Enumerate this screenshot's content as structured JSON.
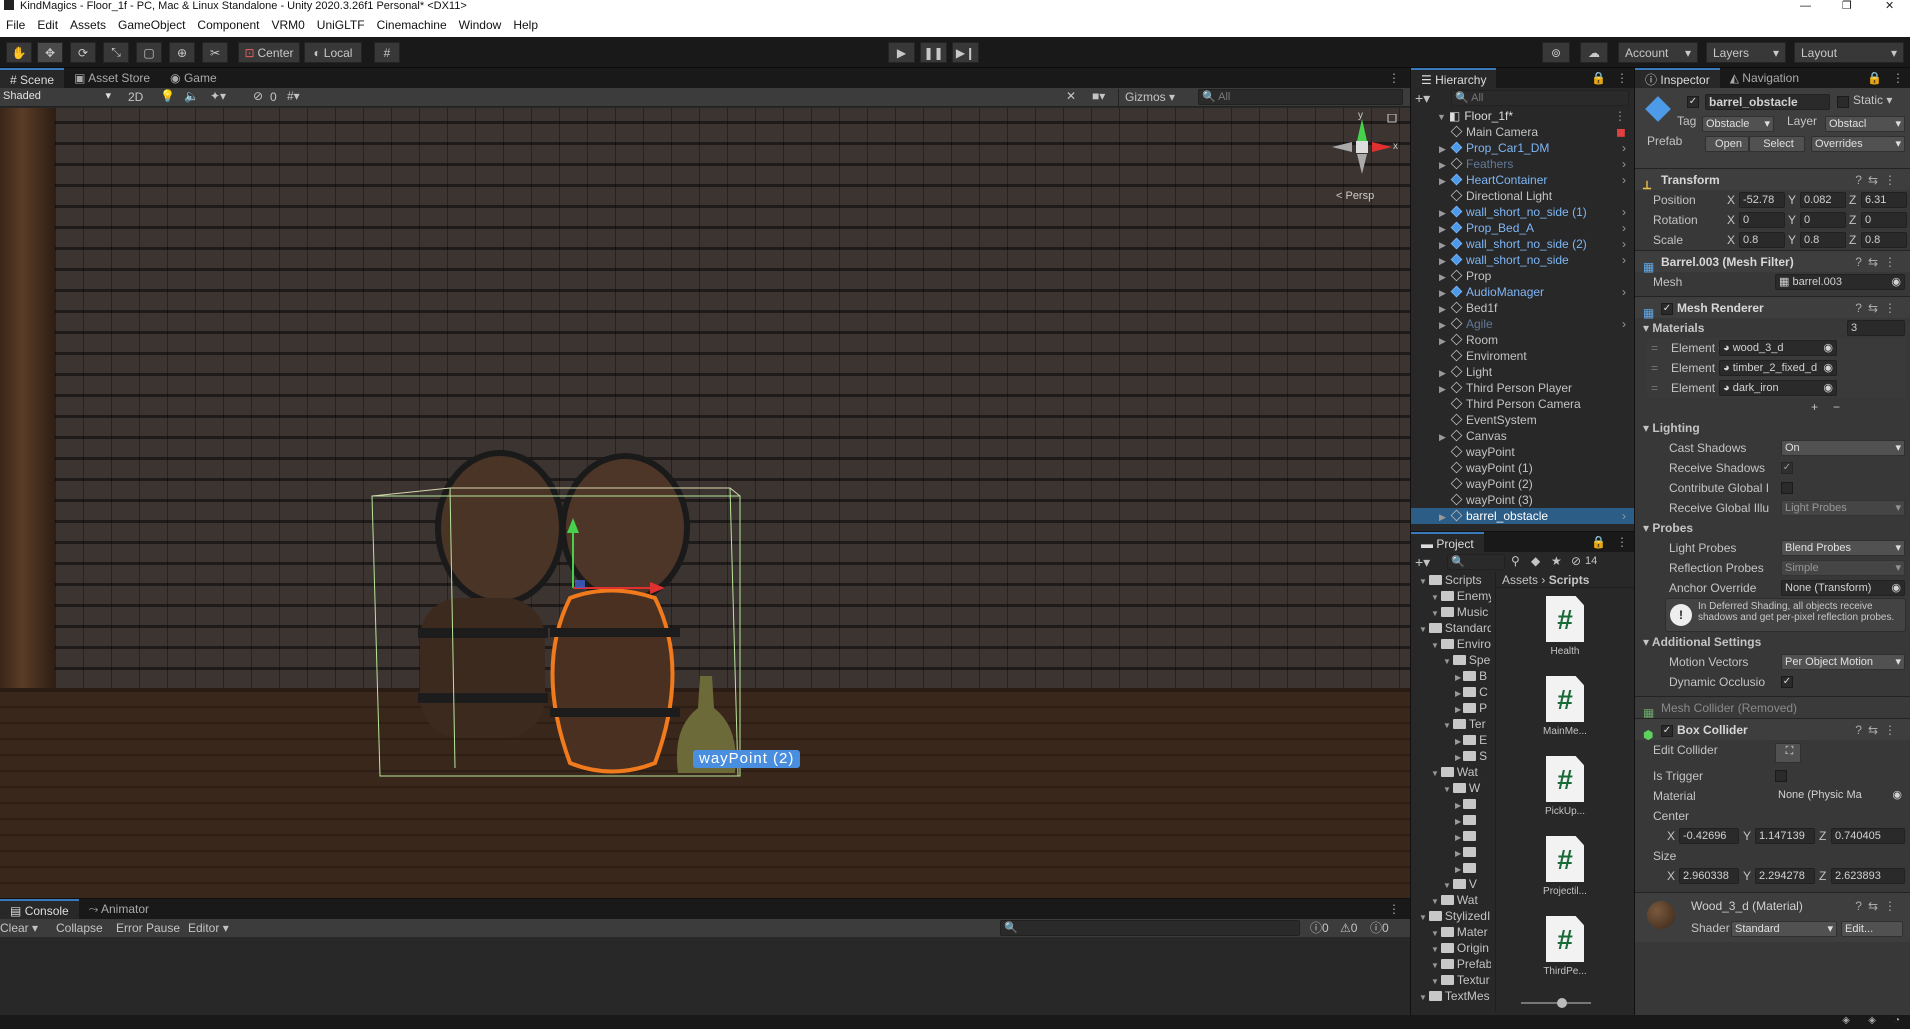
{
  "window": {
    "title": "KindMagics - Floor_1f - PC, Mac & Linux Standalone - Unity 2020.3.26f1 Personal* <DX11>"
  },
  "menu": [
    "File",
    "Edit",
    "Assets",
    "GameObject",
    "Component",
    "VRM0",
    "UniGLTF",
    "Cinemachine",
    "Window",
    "Help"
  ],
  "toolbar": {
    "pivot_label": "Center",
    "space_label": "Local",
    "account_label": "Account",
    "layers_label": "Layers",
    "layout_label": "Layout"
  },
  "scene": {
    "tabs": [
      "Scene",
      "Asset Store",
      "Game"
    ],
    "shading": "Shaded",
    "mode_2d": "2D",
    "hidden_count": "0",
    "gizmos_label": "Gizmos",
    "search_placeholder": "All",
    "persp_label": "< Persp",
    "gizmo_x": "x",
    "gizmo_y": "y",
    "waypoint_label": "wayPoint (2)"
  },
  "console": {
    "tabs": [
      "Console",
      "Animator"
    ],
    "clear": "Clear",
    "collapse": "Collapse",
    "error_pause": "Error Pause",
    "editor": "Editor",
    "counts": [
      "0",
      "0",
      "0"
    ]
  },
  "hierarchy": {
    "title": "Hierarchy",
    "search_placeholder": "All",
    "scene_name": "Floor_1f*",
    "items": [
      {
        "label": "Main Camera",
        "kind": "normal"
      },
      {
        "label": "Prop_Car1_DM",
        "kind": "prefab"
      },
      {
        "label": "Feathers",
        "kind": "disabled"
      },
      {
        "label": "HeartContainer",
        "kind": "prefab"
      },
      {
        "label": "Directional Light",
        "kind": "normal"
      },
      {
        "label": "wall_short_no_side (1)",
        "kind": "prefab"
      },
      {
        "label": "Prop_Bed_A",
        "kind": "prefab"
      },
      {
        "label": "wall_short_no_side (2)",
        "kind": "prefab"
      },
      {
        "label": "wall_short_no_side",
        "kind": "prefab"
      },
      {
        "label": "Prop",
        "kind": "normal"
      },
      {
        "label": "AudioManager",
        "kind": "prefab"
      },
      {
        "label": "Bed1f",
        "kind": "normal"
      },
      {
        "label": "Agile",
        "kind": "disabled"
      },
      {
        "label": "Room",
        "kind": "normal"
      },
      {
        "label": "Enviroment",
        "kind": "normal"
      },
      {
        "label": "Light",
        "kind": "normal"
      },
      {
        "label": "Third Person Player",
        "kind": "normal"
      },
      {
        "label": "Third Person Camera",
        "kind": "normal"
      },
      {
        "label": "EventSystem",
        "kind": "normal"
      },
      {
        "label": "Canvas",
        "kind": "normal"
      },
      {
        "label": "wayPoint",
        "kind": "normal"
      },
      {
        "label": "wayPoint (1)",
        "kind": "normal"
      },
      {
        "label": "wayPoint (2)",
        "kind": "normal"
      },
      {
        "label": "wayPoint (3)",
        "kind": "normal"
      },
      {
        "label": "barrel_obstacle",
        "kind": "selected"
      }
    ]
  },
  "project": {
    "title": "Project",
    "hidden_count": "14",
    "breadcrumb_root": "Assets",
    "breadcrumb_current": "Scripts",
    "tree": [
      {
        "label": "Scripts",
        "indent": 1
      },
      {
        "label": "Enemy",
        "indent": 2
      },
      {
        "label": "Music",
        "indent": 2
      },
      {
        "label": "Standard",
        "indent": 1
      },
      {
        "label": "Enviro",
        "indent": 2
      },
      {
        "label": "Spe",
        "indent": 3
      },
      {
        "label": "B",
        "indent": 4
      },
      {
        "label": "C",
        "indent": 4
      },
      {
        "label": "P",
        "indent": 4
      },
      {
        "label": "Ter",
        "indent": 3
      },
      {
        "label": "E",
        "indent": 4
      },
      {
        "label": "S",
        "indent": 4
      },
      {
        "label": "Wat",
        "indent": 2
      },
      {
        "label": "W",
        "indent": 3
      },
      {
        "label": "",
        "indent": 4
      },
      {
        "label": "",
        "indent": 4
      },
      {
        "label": "",
        "indent": 4
      },
      {
        "label": "",
        "indent": 4
      },
      {
        "label": "",
        "indent": 4
      },
      {
        "label": "V",
        "indent": 3
      },
      {
        "label": "Wat",
        "indent": 2
      },
      {
        "label": "StylizedI",
        "indent": 1
      },
      {
        "label": "Mater",
        "indent": 2
      },
      {
        "label": "Origin",
        "indent": 2
      },
      {
        "label": "Prefab",
        "indent": 2
      },
      {
        "label": "Textur",
        "indent": 2
      },
      {
        "label": "TextMes",
        "indent": 1
      }
    ],
    "files": [
      "Health",
      "MainMe...",
      "PickUp...",
      "Projectil...",
      "ThirdPe..."
    ]
  },
  "inspector": {
    "tabs": [
      "Inspector",
      "Navigation"
    ],
    "object_name": "barrel_obstacle",
    "static_label": "Static",
    "tag_label": "Tag",
    "tag_value": "Obstacle",
    "layer_label": "Layer",
    "layer_value": "Obstacl",
    "prefab_label": "Prefab",
    "prefab_open": "Open",
    "prefab_select": "Select",
    "prefab_overrides": "Overrides",
    "transform": {
      "title": "Transform",
      "position_label": "Position",
      "rotation_label": "Rotation",
      "scale_label": "Scale",
      "position": [
        "-52.78",
        "0.082",
        "6.31"
      ],
      "rotation": [
        "0",
        "0",
        "0"
      ],
      "scale": [
        "0.8",
        "0.8",
        "0.8"
      ]
    },
    "mesh_filter": {
      "title": "Barrel.003 (Mesh Filter)",
      "mesh_label": "Mesh",
      "mesh_value": "barrel.003"
    },
    "mesh_renderer": {
      "title": "Mesh Renderer",
      "materials_label": "Materials",
      "materials_count": "3",
      "elements": [
        {
          "label": "Element 0",
          "value": "wood_3_d"
        },
        {
          "label": "Element 1",
          "value": "timber_2_fixed_d"
        },
        {
          "label": "Element 2",
          "value": "dark_iron"
        }
      ],
      "lighting_label": "Lighting",
      "cast_shadows_label": "Cast Shadows",
      "cast_shadows_value": "On",
      "receive_shadows_label": "Receive Shadows",
      "contribute_gi_label": "Contribute Global I",
      "receive_gi_label": "Receive Global Illu",
      "receive_gi_value": "Light Probes",
      "probes_label": "Probes",
      "light_probes_label": "Light Probes",
      "light_probes_value": "Blend Probes",
      "reflection_probes_label": "Reflection Probes",
      "reflection_probes_value": "Simple",
      "anchor_override_label": "Anchor Override",
      "anchor_override_value": "None (Transform)",
      "info_text": "In Deferred Shading, all objects receive shadows and get per-pixel reflection probes.",
      "additional_label": "Additional Settings",
      "motion_vectors_label": "Motion Vectors",
      "motion_vectors_value": "Per Object Motion",
      "dynamic_occlusion_label": "Dynamic Occlusio"
    },
    "mesh_collider_removed": "Mesh Collider (Removed)",
    "box_collider": {
      "title": "Box Collider",
      "edit_collider_label": "Edit Collider",
      "is_trigger_label": "Is Trigger",
      "material_label": "Material",
      "material_value": "None (Physic Ma",
      "center_label": "Center",
      "center": [
        "-0.42696",
        "1.147139",
        "0.740405"
      ],
      "size_label": "Size",
      "size": [
        "2.960338",
        "2.294278",
        "2.623893"
      ]
    },
    "material": {
      "title": "Wood_3_d (Material)",
      "shader_label": "Shader",
      "shader_value": "Standard",
      "edit_label": "Edit..."
    }
  },
  "colors": {
    "accent": "#3a79bb",
    "selection": "#f07a1c",
    "prefab_text": "#7fb6f5"
  }
}
